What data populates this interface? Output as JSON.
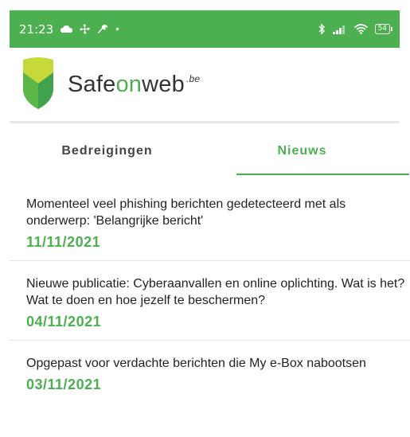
{
  "status_bar": {
    "time": "21:23",
    "left_icons": [
      "cloud-icon",
      "fan-icon",
      "wrench-icon",
      "dot-icon"
    ],
    "right_icons": [
      "bluetooth-icon",
      "signal-icon",
      "wifi-icon"
    ],
    "battery": "54"
  },
  "app_bar": {
    "brand_prefix": "Safe",
    "brand_on": "on",
    "brand_suffix": "web",
    "brand_sup": ".be"
  },
  "tabs": [
    {
      "label": "Bedreigingen",
      "active": false
    },
    {
      "label": "Nieuws",
      "active": true
    }
  ],
  "news": [
    {
      "headline": "Momenteel veel phishing berichten gedetecteerd met als onderwerp: 'Belangrijke bericht'",
      "date": "11/11/2021"
    },
    {
      "headline": "Nieuwe publicatie: Cyberaanvallen en online oplichting. Wat is het? Wat te doen en hoe jezelf te beschermen?",
      "date": "04/11/2021"
    },
    {
      "headline": "Opgepast voor verdachte berichten die My e-Box nabootsen",
      "date": "03/11/2021"
    }
  ],
  "colors": {
    "accent": "#4caf50",
    "logo_light": "#c6d93b",
    "logo_dark": "#3fa34d"
  }
}
